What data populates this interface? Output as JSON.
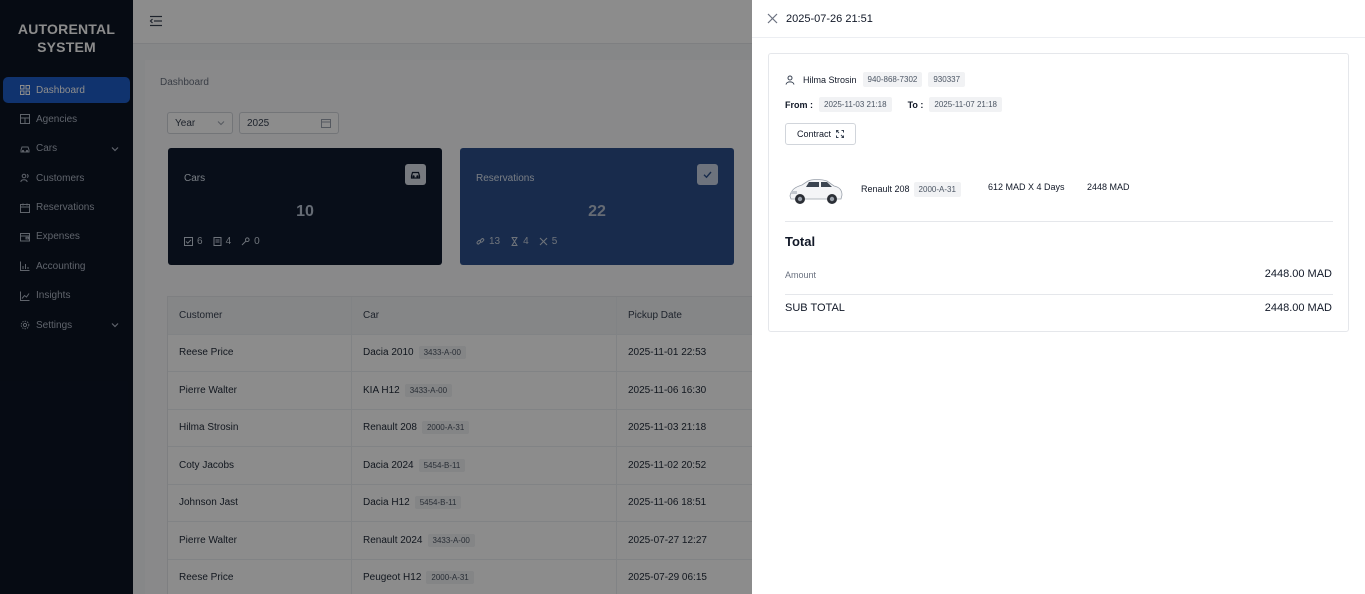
{
  "sidebar": {
    "brand_line1": "AUTORENTAL",
    "brand_line2": "SYSTEM",
    "items": [
      {
        "label": "Dashboard",
        "icon": "grid-icon",
        "active": true
      },
      {
        "label": "Agencies",
        "icon": "building-icon"
      },
      {
        "label": "Cars",
        "icon": "car-icon",
        "has_submenu": true
      },
      {
        "label": "Customers",
        "icon": "users-icon"
      },
      {
        "label": "Reservations",
        "icon": "calendar-icon"
      },
      {
        "label": "Expenses",
        "icon": "wallet-icon"
      },
      {
        "label": "Accounting",
        "icon": "bar-chart-icon"
      },
      {
        "label": "Insights",
        "icon": "line-chart-icon"
      },
      {
        "label": "Settings",
        "icon": "gear-icon",
        "has_submenu": true
      }
    ]
  },
  "main": {
    "breadcrumb": "Dashboard",
    "period_select": "Year",
    "year_value": "2025",
    "cards": {
      "cars": {
        "title": "Cars",
        "value": "10",
        "stats": [
          "6",
          "4",
          "0"
        ]
      },
      "reservations": {
        "title": "Reservations",
        "value": "22",
        "stats": [
          "13",
          "4",
          "5"
        ]
      }
    },
    "table": {
      "headers": [
        "Customer",
        "Car",
        "Pickup Date"
      ],
      "rows": [
        {
          "customer": "Reese Price",
          "car": "Dacia 2010",
          "plate": "3433-A-00",
          "date": "2025-11-01 22:53"
        },
        {
          "customer": "Pierre Walter",
          "car": "KIA H12",
          "plate": "3433-A-00",
          "date": "2025-11-06 16:30"
        },
        {
          "customer": "Hilma Strosin",
          "car": "Renault 208",
          "plate": "2000-A-31",
          "date": "2025-11-03 21:18"
        },
        {
          "customer": "Coty Jacobs",
          "car": "Dacia 2024",
          "plate": "5454-B-11",
          "date": "2025-11-02 20:52"
        },
        {
          "customer": "Johnson Jast",
          "car": "Dacia H12",
          "plate": "5454-B-11",
          "date": "2025-11-06 18:51"
        },
        {
          "customer": "Pierre Walter",
          "car": "Renault 2024",
          "plate": "3433-A-00",
          "date": "2025-07-27 12:27"
        },
        {
          "customer": "Reese Price",
          "car": "Peugeot H12",
          "plate": "2000-A-31",
          "date": "2025-07-29 06:15"
        }
      ]
    }
  },
  "drawer": {
    "title": "2025-07-26 21:51",
    "customer_name": "Hilma Strosin",
    "phone": "940-868-7302",
    "customer_code": "930337",
    "from_label": "From :",
    "from_value": "2025-11-03 21:18",
    "to_label": "To :",
    "to_value": "2025-11-07 21:18",
    "contract_label": "Contract",
    "car_name": "Renault 208",
    "car_plate": "2000-A-31",
    "car_price": "612 MAD X 4 Days",
    "car_total": "2448 MAD",
    "total_title": "Total",
    "amount_label": "Amount",
    "amount_value": "2448.00 MAD",
    "subtotal_label": "SUB TOTAL",
    "subtotal_value": "2448.00 MAD"
  },
  "colors": {
    "sidebar_bg": "#0b1424",
    "active": "#1e5ec8",
    "cars_card": "#0f1b2e",
    "reservations_card": "#2c4f8a"
  }
}
